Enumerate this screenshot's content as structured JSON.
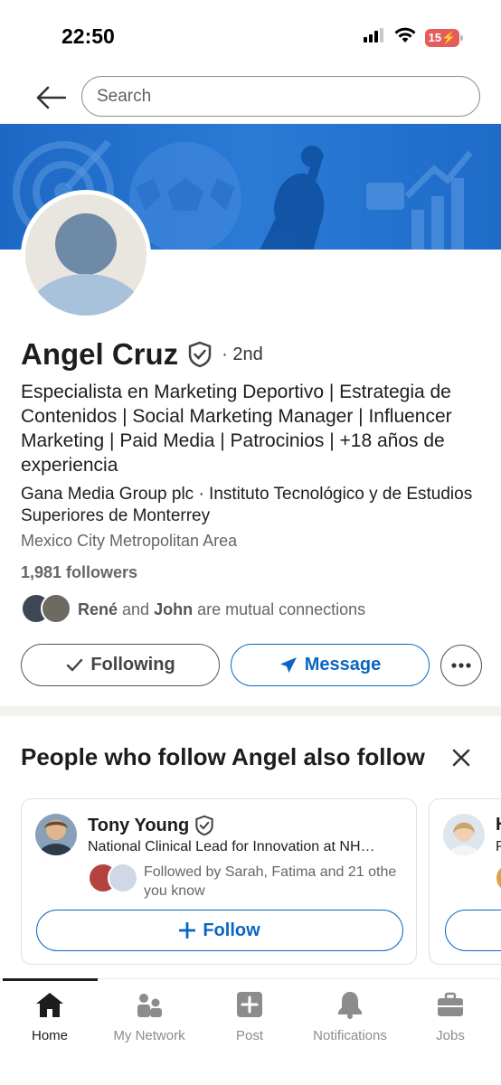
{
  "status_bar": {
    "time": "22:50",
    "battery": "15"
  },
  "search": {
    "placeholder": "Search"
  },
  "profile": {
    "name": "Angel Cruz",
    "degree": "· 2nd",
    "headline": "Especialista en Marketing Deportivo | Estrategia de Contenidos | Social Marketing Manager | Influencer Marketing | Paid Media | Patrocinios | +18 años de experiencia",
    "company": "Gana Media Group plc · Instituto Tecnológico y de Estudios Superiores de Monterrey",
    "location": "Mexico City Metropolitan Area",
    "followers": "1,981 followers",
    "mutual": {
      "name1": "René",
      "and": " and ",
      "name2": "John",
      "suffix": " are mutual connections"
    }
  },
  "actions": {
    "following_label": "Following",
    "message_label": "Message"
  },
  "suggestions": {
    "title": "People who follow Angel also follow",
    "cards": [
      {
        "name": "Tony Young",
        "headline": "National Clinical Lead for Innovation at NH…",
        "mutual": "Followed by Sarah, Fatima and 21 othe you know",
        "follow_label": "Follow"
      },
      {
        "name": "H",
        "headline": "P"
      }
    ]
  },
  "bottom_nav": {
    "items": [
      {
        "label": "Home"
      },
      {
        "label": "My Network"
      },
      {
        "label": "Post"
      },
      {
        "label": "Notifications"
      },
      {
        "label": "Jobs"
      }
    ]
  },
  "colors": {
    "brand": "#0a66c2",
    "banner": "#1d68c4",
    "battery_low": "#e35d5b"
  }
}
